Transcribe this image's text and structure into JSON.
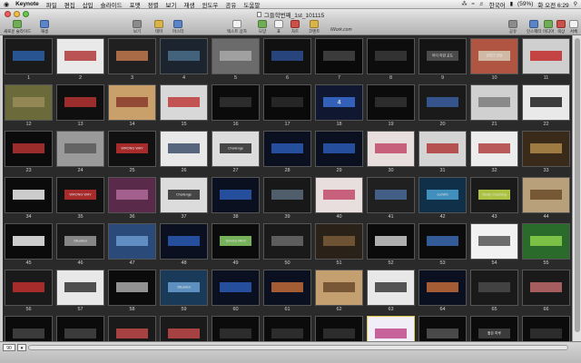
{
  "menubar": {
    "app_name": "Keynote",
    "items": [
      "파일",
      "편집",
      "삽입",
      "슬라이드",
      "포맷",
      "정렬",
      "보기",
      "재생",
      "윈도우",
      "공유",
      "도움말"
    ],
    "status": {
      "language": "한국어",
      "battery": "(59%)",
      "clock": "화 오전 6:29"
    }
  },
  "window": {
    "title": "그들학번째_1st_101115"
  },
  "toolbar": {
    "left_items": [
      "새로운 슬라이드",
      "재생"
    ],
    "items": [
      "보기",
      "테마",
      "마스터",
      "텍스트 상자",
      "모양",
      "표",
      "차트",
      "코멘트",
      "공유",
      "인스펙터",
      "미디어",
      "색상",
      "서체"
    ],
    "iwork_label": "iWork.com"
  },
  "slides": [
    {
      "n": 1,
      "bg": "#1a1a1a",
      "accent": "#2d5fa8",
      "text": ""
    },
    {
      "n": 2,
      "bg": "#e9e9e9",
      "accent": "#b23a3a",
      "text": ""
    },
    {
      "n": 3,
      "bg": "#202020",
      "accent": "#c2794e",
      "text": ""
    },
    {
      "n": 4,
      "bg": "#1c2430",
      "accent": "#4a6d8a",
      "text": ""
    },
    {
      "n": 5,
      "bg": "#6b6b6b",
      "accent": "#a9a9a9",
      "text": ""
    },
    {
      "n": 6,
      "bg": "#111111",
      "accent": "#2b4f8f",
      "text": ""
    },
    {
      "n": 7,
      "bg": "#0a0a0a",
      "accent": "#444444",
      "text": ""
    },
    {
      "n": 8,
      "bg": "#0d0d0d",
      "accent": "#3a3a3a",
      "text": ""
    },
    {
      "n": 9,
      "bg": "#141414",
      "accent": "#555555",
      "text": "어디 이런 곳도"
    },
    {
      "n": 10,
      "bg": "#b05542",
      "accent": "#d6cbb6",
      "text": "관점의 전환"
    },
    {
      "n": 11,
      "bg": "#cfcfcf",
      "accent": "#c22a2a",
      "text": ""
    },
    {
      "n": 12,
      "bg": "#6b6a3a",
      "accent": "#9a8c5a",
      "text": ""
    },
    {
      "n": 13,
      "bg": "#0f0f0f",
      "accent": "#b43333",
      "text": ""
    },
    {
      "n": 14,
      "bg": "#c9a06a",
      "accent": "#8a3b2a",
      "text": ""
    },
    {
      "n": 15,
      "bg": "#d8d8d8",
      "accent": "#c03b3b",
      "text": ""
    },
    {
      "n": 16,
      "bg": "#0b0b0b",
      "accent": "#333333",
      "text": ""
    },
    {
      "n": 17,
      "bg": "#0a0a0a",
      "accent": "#2c2c2c",
      "text": ""
    },
    {
      "n": 18,
      "bg": "#0f1830",
      "accent": "#3a6fd1",
      "text": "4"
    },
    {
      "n": 19,
      "bg": "#0b0b0b",
      "accent": "#333333",
      "text": ""
    },
    {
      "n": 20,
      "bg": "#1a1a1a",
      "accent": "#3b5fa0",
      "text": ""
    },
    {
      "n": 21,
      "bg": "#d0d0d0",
      "accent": "#7e7e7e",
      "text": ""
    },
    {
      "n": 22,
      "bg": "#e9e9e9",
      "accent": "#1e1e1e",
      "text": ""
    },
    {
      "n": 23,
      "bg": "#0b0b0b",
      "accent": "#b43333",
      "text": ""
    },
    {
      "n": 24,
      "bg": "#9a9a9a",
      "accent": "#5a5a5a",
      "text": ""
    },
    {
      "n": 25,
      "bg": "#111111",
      "accent": "#c23030",
      "text": "WRONG WAY"
    },
    {
      "n": 26,
      "bg": "#e8e8e8",
      "accent": "#3d4d6a",
      "text": ""
    },
    {
      "n": 27,
      "bg": "#dcdcdc",
      "accent": "#2a2a2a",
      "text": "Challenge"
    },
    {
      "n": 28,
      "bg": "#0a1020",
      "accent": "#2a5ab4",
      "text": ""
    },
    {
      "n": 29,
      "bg": "#0a1020",
      "accent": "#2a5ab4",
      "text": ""
    },
    {
      "n": 30,
      "bg": "#e8dede",
      "accent": "#c04a6a",
      "text": ""
    },
    {
      "n": 31,
      "bg": "#d4d4d4",
      "accent": "#b03a3a",
      "text": ""
    },
    {
      "n": 32,
      "bg": "#ececec",
      "accent": "#b04040",
      "text": ""
    },
    {
      "n": 33,
      "bg": "#3a2a1a",
      "accent": "#b08a4a",
      "text": ""
    },
    {
      "n": 34,
      "bg": "#0b0b0b",
      "accent": "#eeeeee",
      "text": ""
    },
    {
      "n": 35,
      "bg": "#111111",
      "accent": "#c23030",
      "text": "WRONG WAY"
    },
    {
      "n": 36,
      "bg": "#5a2a4a",
      "accent": "#b06a9a",
      "text": ""
    },
    {
      "n": 37,
      "bg": "#dcdcdc",
      "accent": "#2a2a2a",
      "text": "Challenge"
    },
    {
      "n": 38,
      "bg": "#0a1020",
      "accent": "#2a5ab4",
      "text": ""
    },
    {
      "n": 39,
      "bg": "#181818",
      "accent": "#5a6a7a",
      "text": ""
    },
    {
      "n": 40,
      "bg": "#e8dede",
      "accent": "#c04a6a",
      "text": ""
    },
    {
      "n": 41,
      "bg": "#202020",
      "accent": "#4a6a9a",
      "text": ""
    },
    {
      "n": 42,
      "bg": "#10304a",
      "accent": "#4aa0d0",
      "text": "cooWS"
    },
    {
      "n": 43,
      "bg": "#1a1a1a",
      "accent": "#c6e04a",
      "text": "Study Coaching"
    },
    {
      "n": 44,
      "bg": "#b8a07a",
      "accent": "#6a4a2a",
      "text": ""
    },
    {
      "n": 45,
      "bg": "#0b0b0b",
      "accent": "#eeeeee",
      "text": ""
    },
    {
      "n": 46,
      "bg": "#181818",
      "accent": "#9a9a9a",
      "text": "Situation"
    },
    {
      "n": 47,
      "bg": "#2a4a7a",
      "accent": "#6a9ad0",
      "text": ""
    },
    {
      "n": 48,
      "bg": "#0a1020",
      "accent": "#2a5ab4",
      "text": ""
    },
    {
      "n": 49,
      "bg": "#0b0b0b",
      "accent": "#8ad06a",
      "text": "Service Mind"
    },
    {
      "n": 50,
      "bg": "#1a1a1a",
      "accent": "#6a6a6a",
      "text": ""
    },
    {
      "n": 51,
      "bg": "#2a2218",
      "accent": "#7a5a3a",
      "text": ""
    },
    {
      "n": 52,
      "bg": "#0b0b0b",
      "accent": "#cccccc",
      "text": ""
    },
    {
      "n": 53,
      "bg": "#0b0b0b",
      "accent": "#3a6ab0",
      "text": ""
    },
    {
      "n": 54,
      "bg": "#f2f2f2",
      "accent": "#555555",
      "text": ""
    },
    {
      "n": 55,
      "bg": "#2a6a2a",
      "accent": "#8ad04a",
      "text": ""
    },
    {
      "n": 56,
      "bg": "#1a1a1a",
      "accent": "#c03030",
      "text": ""
    },
    {
      "n": 57,
      "bg": "#e8e8e8",
      "accent": "#333333",
      "text": ""
    },
    {
      "n": 58,
      "bg": "#0b0b0b",
      "accent": "#aaaaaa",
      "text": ""
    },
    {
      "n": 59,
      "bg": "#1a3a5a",
      "accent": "#6aa0d0",
      "text": "Situation"
    },
    {
      "n": 60,
      "bg": "#0a1020",
      "accent": "#2a5ab4",
      "text": ""
    },
    {
      "n": 61,
      "bg": "#0a1020",
      "accent": "#c06a3a",
      "text": ""
    },
    {
      "n": 62,
      "bg": "#c4a070",
      "accent": "#6a4a2a",
      "text": ""
    },
    {
      "n": 63,
      "bg": "#e8e8e8",
      "accent": "#3a3a3a",
      "text": ""
    },
    {
      "n": 64,
      "bg": "#0a1020",
      "accent": "#c06a3a",
      "text": ""
    },
    {
      "n": 65,
      "bg": "#1a1a1a",
      "accent": "#4a4a4a",
      "text": ""
    },
    {
      "n": 66,
      "bg": "#1a1a1a",
      "accent": "#c06a6a",
      "text": ""
    },
    {
      "n": 67,
      "bg": "#0b0b0b",
      "accent": "#444444",
      "text": ""
    },
    {
      "n": 68,
      "bg": "#0b0b0b",
      "accent": "#444444",
      "text": ""
    },
    {
      "n": 69,
      "bg": "#1a1a1a",
      "accent": "#c04a4a",
      "text": ""
    },
    {
      "n": 70,
      "bg": "#1a1a1a",
      "accent": "#c04a4a",
      "text": ""
    },
    {
      "n": 71,
      "bg": "#0b0b0b",
      "accent": "#333333",
      "text": ""
    },
    {
      "n": 72,
      "bg": "#0b0b0b",
      "accent": "#333333",
      "text": ""
    },
    {
      "n": 73,
      "bg": "#0b0b0b",
      "accent": "#333333",
      "text": ""
    },
    {
      "n": 74,
      "bg": "#f2eef8",
      "accent": "#c04a8a",
      "text": "",
      "selected": true
    },
    {
      "n": 75,
      "bg": "#0b0b0b",
      "accent": "#555555",
      "text": ""
    },
    {
      "n": 76,
      "bg": "#0b0b0b",
      "accent": "#444444",
      "text": "좋은 하루"
    },
    {
      "n": 77,
      "bg": "#0b0b0b",
      "accent": "#333333",
      "text": ""
    }
  ],
  "status": {
    "zoom": "90"
  }
}
